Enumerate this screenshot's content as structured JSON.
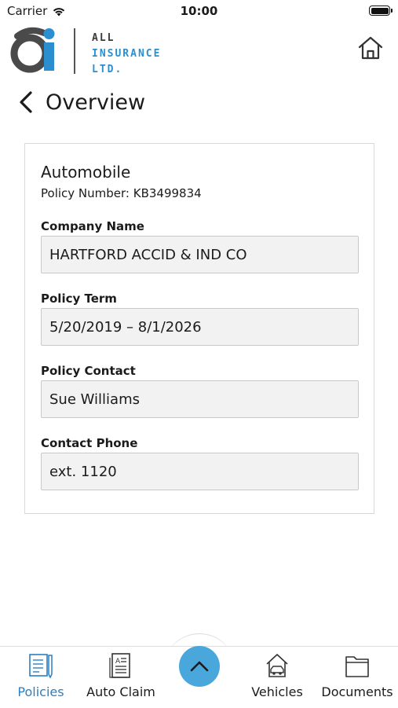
{
  "status_bar": {
    "carrier": "Carrier",
    "time": "10:00"
  },
  "logo": {
    "line1": "ALL",
    "line2": "INSURANCE",
    "line3": "LTD."
  },
  "page": {
    "title": "Overview"
  },
  "policy": {
    "type": "Automobile",
    "number_text": "Policy Number: KB3499834",
    "fields": [
      {
        "label": "Company Name",
        "value": "HARTFORD ACCID & IND CO"
      },
      {
        "label": "Policy Term",
        "value": "5/20/2019 – 8/1/2026"
      },
      {
        "label": "Policy Contact",
        "value": "Sue Williams"
      },
      {
        "label": "Contact Phone",
        "value": "ext. 1120"
      }
    ]
  },
  "tabs": [
    {
      "label": "Policies",
      "icon": "policies-icon",
      "active": true
    },
    {
      "label": "Auto Claim",
      "icon": "auto-claim-icon",
      "active": false
    },
    {
      "label": "Vehicles",
      "icon": "vehicles-icon",
      "active": false
    },
    {
      "label": "Documents",
      "icon": "documents-icon",
      "active": false
    }
  ],
  "colors": {
    "accent": "#2b7fc2",
    "fab": "#4aa7dc",
    "field_bg": "#f2f2f2"
  }
}
